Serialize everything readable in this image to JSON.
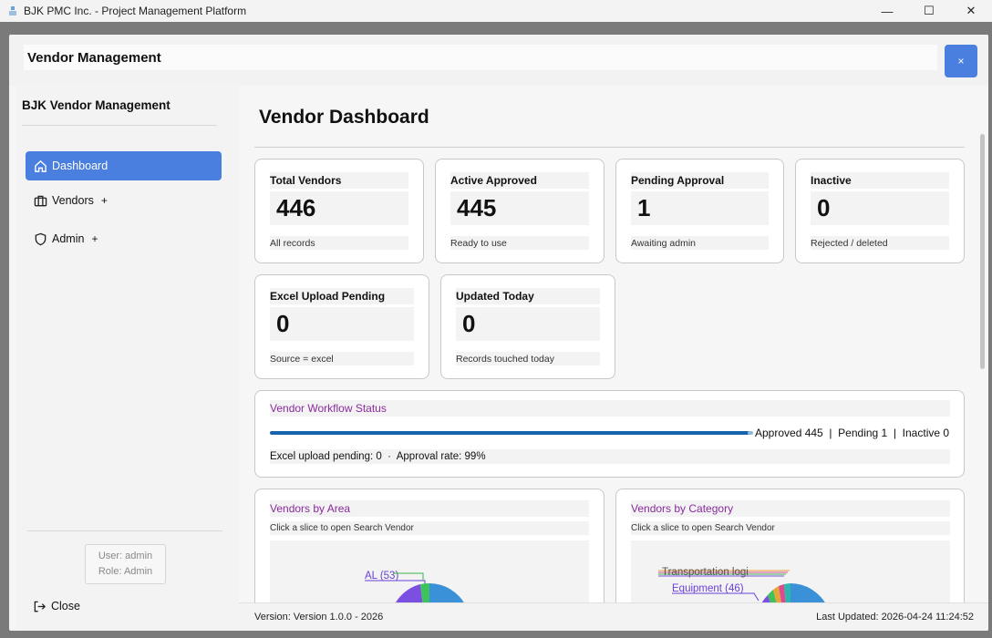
{
  "os": {
    "title": "BJK PMC Inc. - Project Management Platform",
    "minimize": "—",
    "maximize": "☐",
    "close": "✕"
  },
  "dialog": {
    "title": "Vendor Management",
    "close_label": "×"
  },
  "sidebar": {
    "title": "BJK Vendor Management",
    "items": [
      {
        "label": "Dashboard",
        "icon": "home-icon",
        "active": true,
        "expand": ""
      },
      {
        "label": "Vendors",
        "icon": "briefcase-icon",
        "active": false,
        "expand": "+"
      },
      {
        "label": "Admin",
        "icon": "shield-icon",
        "active": false,
        "expand": "+"
      }
    ],
    "user_line": "User: admin",
    "role_line": "Role: Admin",
    "close_label": "Close"
  },
  "main": {
    "page_title": "Vendor Dashboard",
    "cards": [
      {
        "label": "Total Vendors",
        "value": "446",
        "sub": "All records"
      },
      {
        "label": "Active Approved",
        "value": "445",
        "sub": "Ready to use"
      },
      {
        "label": "Pending Approval",
        "value": "1",
        "sub": "Awaiting admin"
      },
      {
        "label": "Inactive",
        "value": "0",
        "sub": "Rejected / deleted"
      },
      {
        "label": "Excel Upload Pending",
        "value": "0",
        "sub": "Source = excel"
      },
      {
        "label": "Updated Today",
        "value": "0",
        "sub": "Records touched today"
      }
    ],
    "workflow": {
      "title": "Vendor Workflow Status",
      "status_text": "Approved 445  |  Pending 1  |  Inactive 0",
      "approved_fraction": 0.99,
      "footer": "Excel upload pending: 0  ·  Approval rate: 99%"
    },
    "area_chart": {
      "title": "Vendors by Area",
      "subtitle": "Click a slice to open Search Vendor",
      "visible_label": "AL (53)"
    },
    "category_chart": {
      "title": "Vendors by Category",
      "subtitle": "Click a slice to open Search Vendor",
      "visible_labels": [
        "Transportation logi",
        "Equipment (46)"
      ]
    },
    "footer": {
      "version": "Version: Version 1.0.0 - 2026",
      "last_updated": "Last Updated: 2026-04-24 11:24:52"
    }
  },
  "colors": {
    "accent": "#4a7fe0",
    "chart_title": "#8b2aa0",
    "progress": "#1763ad"
  }
}
